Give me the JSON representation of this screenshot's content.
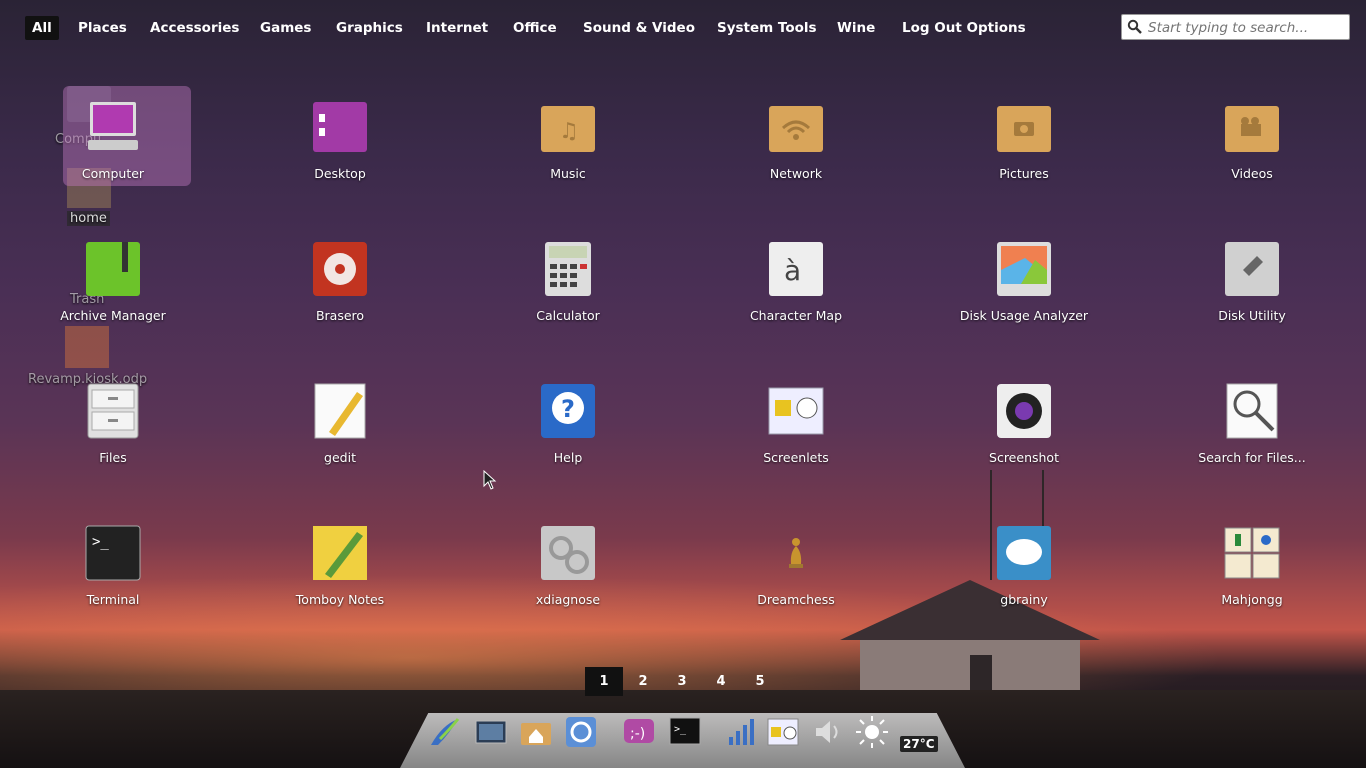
{
  "categories": [
    {
      "label": "All",
      "active": true
    },
    {
      "label": "Places"
    },
    {
      "label": "Accessories"
    },
    {
      "label": "Games"
    },
    {
      "label": "Graphics"
    },
    {
      "label": "Internet"
    },
    {
      "label": "Office"
    },
    {
      "label": "Sound & Video"
    },
    {
      "label": "System Tools"
    },
    {
      "label": "Wine"
    },
    {
      "label": "Log Out Options"
    }
  ],
  "search": {
    "placeholder": "Start typing to search..."
  },
  "desktop_icons": [
    {
      "label": "Compu"
    },
    {
      "label": "home"
    },
    {
      "label": "Trash"
    },
    {
      "label": "Revamp.kiosk.odp"
    }
  ],
  "apps": [
    {
      "label": "Computer",
      "icon": "computer-icon",
      "selected": true
    },
    {
      "label": "Desktop",
      "icon": "desktop-folder-icon"
    },
    {
      "label": "Music",
      "icon": "music-folder-icon"
    },
    {
      "label": "Network",
      "icon": "network-folder-icon"
    },
    {
      "label": "Pictures",
      "icon": "pictures-folder-icon"
    },
    {
      "label": "Videos",
      "icon": "videos-folder-icon"
    },
    {
      "label": "Archive Manager",
      "icon": "archive-manager-icon"
    },
    {
      "label": "Brasero",
      "icon": "brasero-icon"
    },
    {
      "label": "Calculator",
      "icon": "calculator-icon"
    },
    {
      "label": "Character Map",
      "icon": "character-map-icon",
      "glyph": "à"
    },
    {
      "label": "Disk Usage Analyzer",
      "icon": "disk-usage-icon"
    },
    {
      "label": "Disk Utility",
      "icon": "disk-utility-icon"
    },
    {
      "label": "Files",
      "icon": "files-icon"
    },
    {
      "label": "gedit",
      "icon": "gedit-icon"
    },
    {
      "label": "Help",
      "icon": "help-icon",
      "glyph": "?"
    },
    {
      "label": "Screenlets",
      "icon": "screenlets-icon"
    },
    {
      "label": "Screenshot",
      "icon": "screenshot-icon"
    },
    {
      "label": "Search for Files...",
      "icon": "search-files-icon"
    },
    {
      "label": "Terminal",
      "icon": "terminal-icon",
      "glyph": ">_"
    },
    {
      "label": "Tomboy Notes",
      "icon": "tomboy-notes-icon"
    },
    {
      "label": "xdiagnose",
      "icon": "xdiagnose-icon"
    },
    {
      "label": "Dreamchess",
      "icon": "dreamchess-icon"
    },
    {
      "label": "gbrainy",
      "icon": "gbrainy-icon"
    },
    {
      "label": "Mahjongg",
      "icon": "mahjongg-icon"
    }
  ],
  "pages": [
    {
      "label": "1",
      "active": true
    },
    {
      "label": "2"
    },
    {
      "label": "3"
    },
    {
      "label": "4"
    },
    {
      "label": "5"
    }
  ],
  "dock": {
    "items": [
      "menu-icon",
      "desktop-icon",
      "home-folder-icon",
      "chromium-icon",
      "pidgin-icon",
      "terminal-icon",
      "network-signal-icon",
      "screenlets-icon",
      "volume-icon",
      "brightness-icon"
    ],
    "weather": "27°C"
  }
}
